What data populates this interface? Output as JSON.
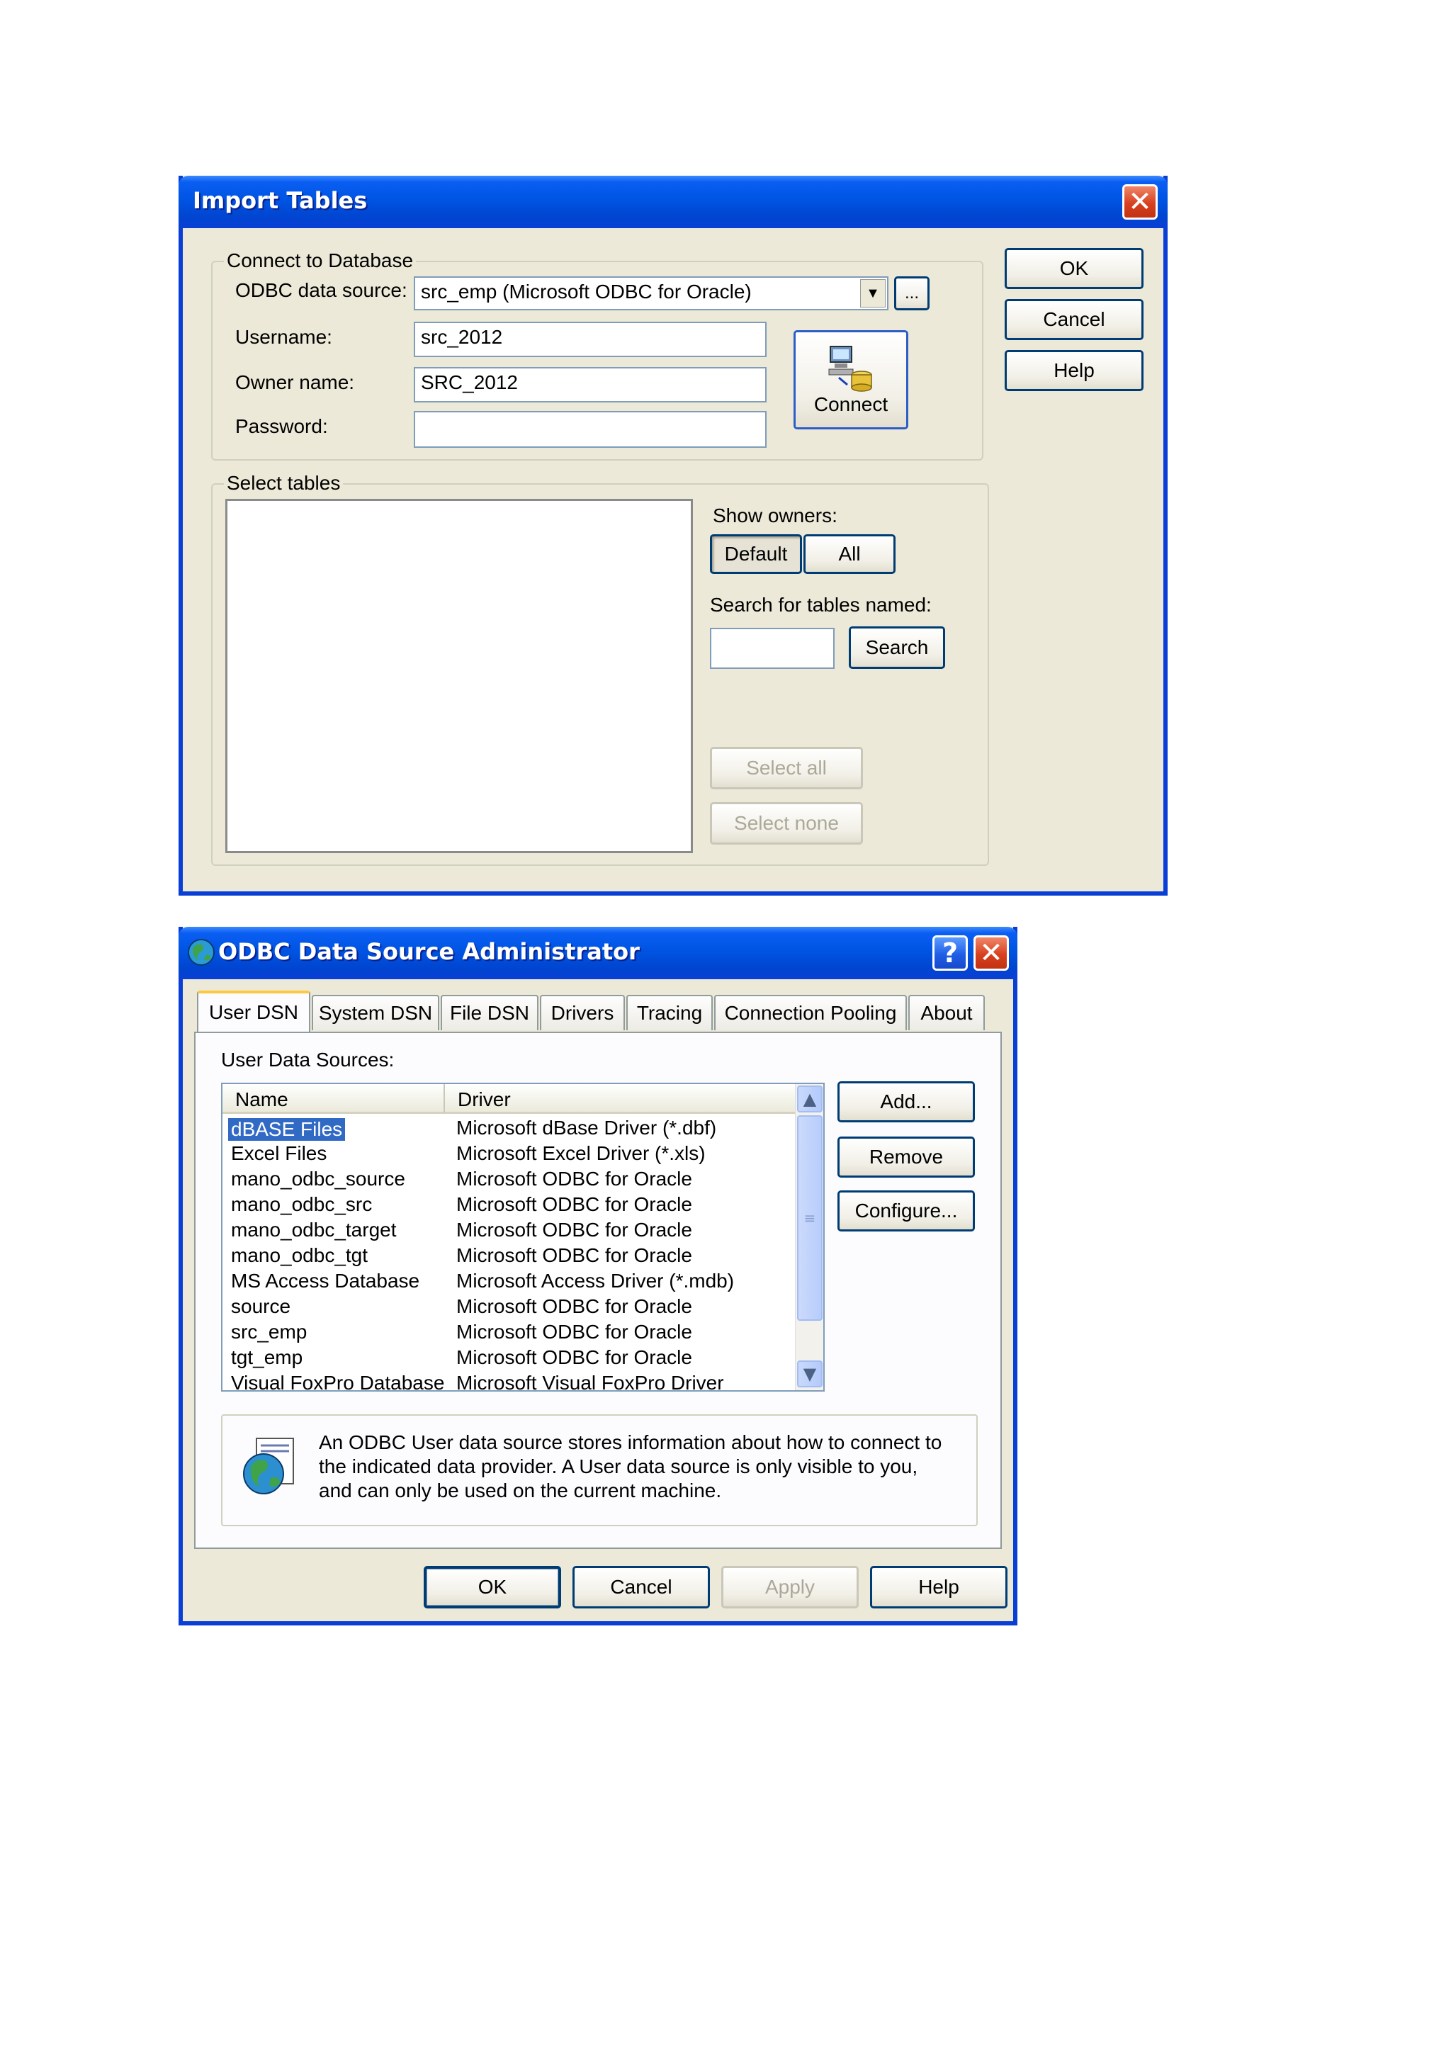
{
  "import_tables": {
    "title": "Import Tables",
    "connect_group": "Connect to Database",
    "odbc_label": "ODBC data source:",
    "odbc_value": "src_emp (Microsoft ODBC for Oracle)",
    "browse_label": "...",
    "username_label": "Username:",
    "username_value": "src_2012",
    "owner_label": "Owner name:",
    "owner_value": "SRC_2012",
    "password_label": "Password:",
    "password_value": "",
    "connect_label": "Connect",
    "ok_label": "OK",
    "cancel_label": "Cancel",
    "help_label": "Help",
    "select_group": "Select tables",
    "show_owners_label": "Show owners:",
    "default_label": "Default",
    "all_label": "All",
    "search_tables_label": "Search for tables named:",
    "search_value": "",
    "search_label": "Search",
    "select_all_label": "Select all",
    "select_none_label": "Select none"
  },
  "odbc_admin": {
    "title": "ODBC Data Source Administrator",
    "tabs": [
      "User DSN",
      "System DSN",
      "File DSN",
      "Drivers",
      "Tracing",
      "Connection Pooling",
      "About"
    ],
    "user_sources_label": "User Data Sources:",
    "columns": [
      "Name",
      "Driver"
    ],
    "rows": [
      {
        "name": "dBASE Files",
        "driver": "Microsoft dBase Driver (*.dbf)"
      },
      {
        "name": "Excel Files",
        "driver": "Microsoft Excel Driver (*.xls)"
      },
      {
        "name": "mano_odbc_source",
        "driver": "Microsoft ODBC for Oracle"
      },
      {
        "name": "mano_odbc_src",
        "driver": "Microsoft ODBC for Oracle"
      },
      {
        "name": "mano_odbc_target",
        "driver": "Microsoft ODBC for Oracle"
      },
      {
        "name": "mano_odbc_tgt",
        "driver": "Microsoft ODBC for Oracle"
      },
      {
        "name": "MS Access Database",
        "driver": "Microsoft Access Driver (*.mdb)"
      },
      {
        "name": "source",
        "driver": "Microsoft ODBC for Oracle"
      },
      {
        "name": "src_emp",
        "driver": "Microsoft ODBC for Oracle"
      },
      {
        "name": "tgt_emp",
        "driver": "Microsoft ODBC for Oracle"
      },
      {
        "name": "Visual FoxPro Database",
        "driver": "Microsoft Visual FoxPro Driver"
      }
    ],
    "add_label": "Add...",
    "remove_label": "Remove",
    "configure_label": "Configure...",
    "info_line1": "An ODBC User data source stores information about how to connect to",
    "info_line2": "the indicated data provider.   A User data source is only visible to you,",
    "info_line3": "and can only be used on the current machine.",
    "ok_label": "OK",
    "cancel_label": "Cancel",
    "apply_label": "Apply",
    "help_label": "Help"
  }
}
